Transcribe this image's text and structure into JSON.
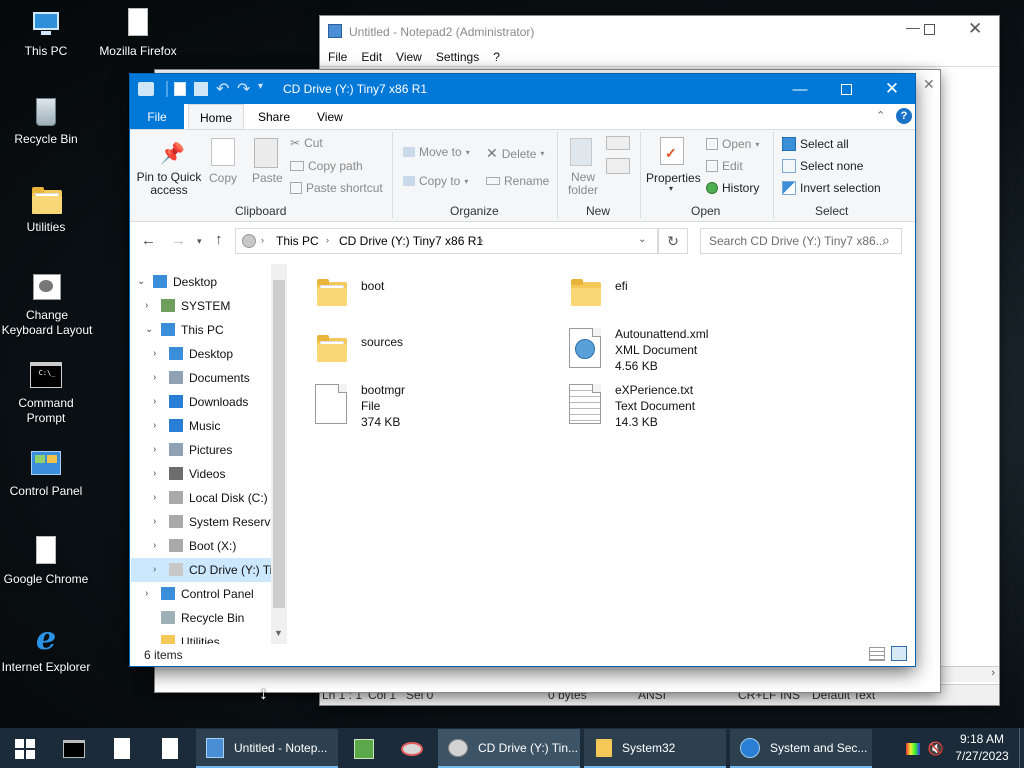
{
  "desktop": {
    "icons": [
      {
        "label": "This PC",
        "icon": "this-pc-icon"
      },
      {
        "label": "Mozilla Firefox",
        "icon": "file-icon"
      },
      {
        "label": "Recycle Bin",
        "icon": "recycle-bin-icon"
      },
      {
        "label": "Utilities",
        "icon": "folder-icon"
      },
      {
        "label": "Change Keyboard Layout",
        "icon": "keyboard-layout-icon"
      },
      {
        "label": "Command Prompt",
        "icon": "command-prompt-icon"
      },
      {
        "label": "Control Panel",
        "icon": "control-panel-icon"
      },
      {
        "label": "Google Chrome",
        "icon": "file-icon"
      },
      {
        "label": "Internet Explorer",
        "icon": "internet-explorer-icon"
      }
    ]
  },
  "notepad": {
    "title": "Untitled - Notepad2 (Administrator)",
    "menu": [
      "File",
      "Edit",
      "View",
      "Settings",
      "?"
    ],
    "status": [
      "Ln 1 : 1",
      "Col 1",
      "Sel 0",
      "0 bytes",
      "ANSI",
      "CR+LF",
      "INS",
      "Default Text"
    ]
  },
  "explorer": {
    "title": "CD Drive (Y:) Tiny7 x86 R1",
    "tabs": [
      "File",
      "Home",
      "Share",
      "View"
    ],
    "active_tab": "Home",
    "ribbon": {
      "clipboard": {
        "group": "Clipboard",
        "pin": "Pin to Quick access",
        "copy": "Copy",
        "paste": "Paste",
        "cut": "Cut",
        "copy_path": "Copy path",
        "paste_shortcut": "Paste shortcut"
      },
      "organize": {
        "group": "Organize",
        "move_to": "Move to",
        "copy_to": "Copy to",
        "delete": "Delete",
        "rename": "Rename"
      },
      "new": {
        "group": "New",
        "new_folder": "New folder"
      },
      "open": {
        "group": "Open",
        "properties": "Properties",
        "open": "Open",
        "edit": "Edit",
        "history": "History"
      },
      "select": {
        "group": "Select",
        "select_all": "Select all",
        "select_none": "Select none",
        "invert": "Invert selection"
      }
    },
    "breadcrumb": [
      "This PC",
      "CD Drive (Y:) Tiny7 x86 R1"
    ],
    "search_placeholder": "Search CD Drive (Y:) Tiny7 x86...",
    "nav": [
      {
        "label": "Desktop",
        "icon": "desktop-icon",
        "level": 0,
        "expand": "open"
      },
      {
        "label": "SYSTEM",
        "icon": "user-icon",
        "level": 1,
        "expand": "closed"
      },
      {
        "label": "This PC",
        "icon": "this-pc-icon",
        "level": 1,
        "expand": "open"
      },
      {
        "label": "Desktop",
        "icon": "desktop-icon",
        "level": 2,
        "expand": "closed"
      },
      {
        "label": "Documents",
        "icon": "documents-icon",
        "level": 2,
        "expand": "closed"
      },
      {
        "label": "Downloads",
        "icon": "downloads-icon",
        "level": 2,
        "expand": "closed"
      },
      {
        "label": "Music",
        "icon": "music-icon",
        "level": 2,
        "expand": "closed"
      },
      {
        "label": "Pictures",
        "icon": "pictures-icon",
        "level": 2,
        "expand": "closed"
      },
      {
        "label": "Videos",
        "icon": "videos-icon",
        "level": 2,
        "expand": "closed"
      },
      {
        "label": "Local Disk (C:)",
        "icon": "drive-icon",
        "level": 2,
        "expand": "closed"
      },
      {
        "label": "System Reserve",
        "icon": "drive-icon",
        "level": 2,
        "expand": "closed"
      },
      {
        "label": "Boot (X:)",
        "icon": "drive-icon",
        "level": 2,
        "expand": "closed"
      },
      {
        "label": "CD Drive (Y:) Ti",
        "icon": "cd-drive-icon",
        "level": 2,
        "expand": "closed",
        "selected": true
      },
      {
        "label": "Control Panel",
        "icon": "control-panel-icon",
        "level": 1,
        "expand": "closed"
      },
      {
        "label": "Recycle Bin",
        "icon": "recycle-bin-icon",
        "level": 1,
        "expand": "none"
      },
      {
        "label": "Utilities",
        "icon": "folder-icon",
        "level": 1,
        "expand": "none"
      }
    ],
    "files": [
      {
        "name": "boot",
        "type": "",
        "size": "",
        "icon": "folder-icon"
      },
      {
        "name": "efi",
        "type": "",
        "size": "",
        "icon": "folder-icon"
      },
      {
        "name": "sources",
        "type": "",
        "size": "",
        "icon": "folder-icon"
      },
      {
        "name": "Autounattend.xml",
        "type": "XML Document",
        "size": "4.56 KB",
        "icon": "xml-file-icon"
      },
      {
        "name": "bootmgr",
        "type": "File",
        "size": "374 KB",
        "icon": "file-icon"
      },
      {
        "name": "eXPerience.txt",
        "type": "Text Document",
        "size": "14.3 KB",
        "icon": "text-file-icon"
      }
    ],
    "status": "6 items"
  },
  "taskbar": {
    "items": [
      {
        "label": "Untitled - Notep...",
        "icon": "notepad-icon",
        "active": false
      },
      {
        "label": "CD Drive (Y:) Tin...",
        "icon": "explorer-icon",
        "active": true
      },
      {
        "label": "System32",
        "icon": "folder-icon",
        "active": false
      },
      {
        "label": "System and Sec...",
        "icon": "control-panel-icon",
        "active": false
      }
    ],
    "time": "9:18 AM",
    "date": "7/27/2023"
  },
  "colors": {
    "accent": "#0078d7",
    "taskbar": "#1b2b3a",
    "folder": "#f4c958"
  }
}
